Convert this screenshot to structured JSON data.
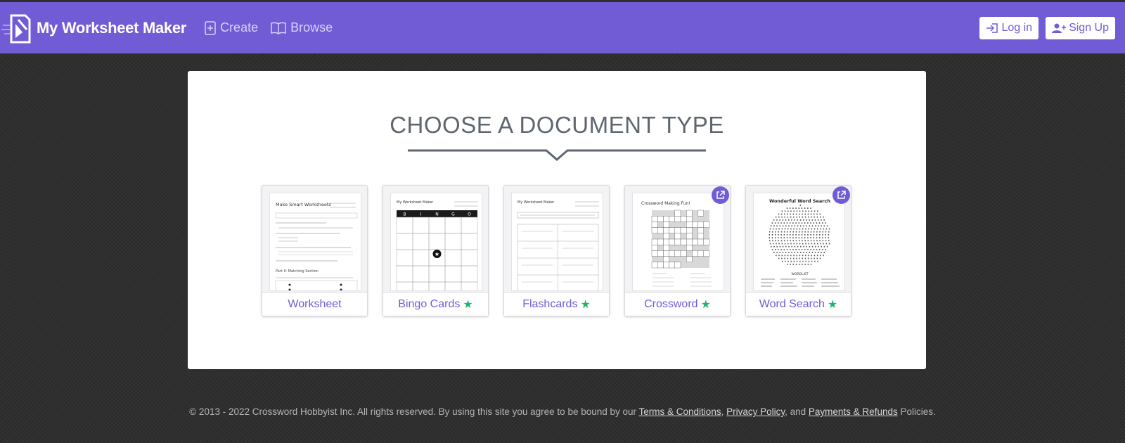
{
  "header": {
    "brand_name": "My Worksheet Maker",
    "brand_icon": "worksheet-logo-icon",
    "nav": [
      {
        "label": "Create",
        "icon": "plus-square-icon"
      },
      {
        "label": "Browse",
        "icon": "open-book-icon"
      }
    ],
    "login_label": "Log in",
    "signup_label": "Sign Up",
    "bar_color": "#715cd6"
  },
  "main": {
    "title": "CHOOSE A DOCUMENT TYPE",
    "cards": [
      {
        "label": "Worksheet",
        "starred": false,
        "external": false,
        "thumb_title": "Make Smart Worksheets",
        "thumb_section": "Part II: Matching Section"
      },
      {
        "label": "Bingo Cards",
        "starred": true,
        "external": false,
        "thumb_title": "My Worksheet Maker",
        "bingo_letters": [
          "B",
          "I",
          "N",
          "G",
          "O"
        ]
      },
      {
        "label": "Flashcards",
        "starred": true,
        "external": false,
        "thumb_title": "My Worksheet Maker"
      },
      {
        "label": "Crossword",
        "starred": true,
        "external": true,
        "thumb_title": "Crossword Making Fun!"
      },
      {
        "label": "Word Search",
        "starred": true,
        "external": true,
        "thumb_title": "Wonderful Word Search",
        "thumb_section": "WORDLIST"
      }
    ],
    "star_color": "#1fb36e"
  },
  "footer": {
    "text_before": "© 2013 - 2022 Crossword Hobbyist Inc. All rights reserved. By using this site you agree to be bound by our ",
    "terms_link": "Terms & Conditions",
    "sep1": ", ",
    "privacy_link": "Privacy Policy",
    "sep2": ", and ",
    "payments_link": "Payments & Refunds",
    "text_after": " Policies."
  }
}
